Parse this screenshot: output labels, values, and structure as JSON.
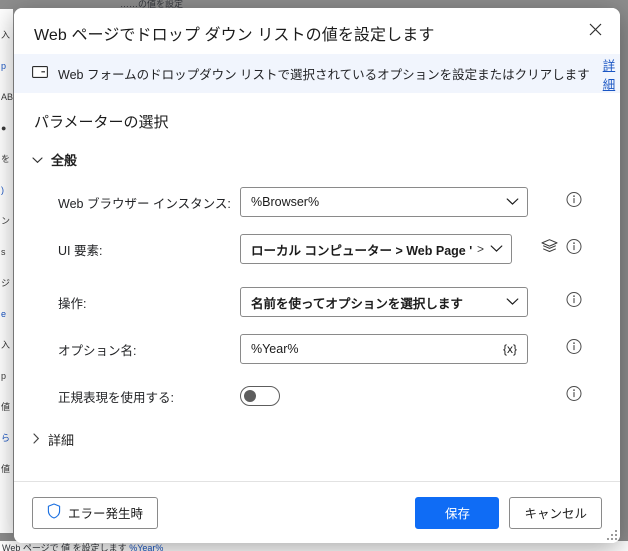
{
  "window": {
    "title": "Web ページでドロップ ダウン リストの値を設定します",
    "close_label": "×"
  },
  "banner": {
    "icon": "dropdown-list-icon",
    "text": "Web フォームのドロップダウン リストで選択されているオプションを設定またはクリアします",
    "link_label": "詳細"
  },
  "body": {
    "section_title": "パラメーターの選択",
    "groups": [
      {
        "label": "全般",
        "expanded": true,
        "chevron": "chevron-down-icon"
      },
      {
        "label": "詳細",
        "expanded": false,
        "chevron": "chevron-right-icon"
      }
    ],
    "fields": [
      {
        "label": "Web ブラウザー インスタンス:",
        "control": "dropdown",
        "value": "%Browser%",
        "bold": false,
        "suffix": "",
        "has_layers_icon": false,
        "has_info_icon": true
      },
      {
        "label": "UI 要素:",
        "control": "dropdown",
        "value": "ローカル コンピューター > Web Page 'h ... egist.html'",
        "bold": true,
        "suffix": ">",
        "has_layers_icon": true,
        "has_info_icon": true
      },
      {
        "label": "操作:",
        "control": "dropdown",
        "value": "名前を使ってオプションを選択します",
        "bold": true,
        "suffix": "",
        "has_layers_icon": false,
        "has_info_icon": true
      },
      {
        "label": "オプション名:",
        "control": "textfield",
        "value": "%Year%",
        "placeholder": "",
        "bold": false,
        "variable_button": "{x}",
        "has_layers_icon": false,
        "has_info_icon": true
      },
      {
        "label": "正規表現を使用する:",
        "control": "toggle",
        "value": "off",
        "has_layers_icon": false,
        "has_info_icon": true
      }
    ]
  },
  "footer": {
    "error_button_label": "エラー発生時",
    "error_button_icon": "shield-icon",
    "save_label": "保存",
    "cancel_label": "キャンセル"
  },
  "background": {
    "top_text": "……の値を設定",
    "bottom_text_plain": "Web ページで 値 を設定します",
    "bottom_text_link": "%Year%",
    "left_lines": [
      "入",
      "p",
      "AB",
      "●",
      "を",
      ")",
      "ン",
      "s",
      "ジ",
      "e",
      "入",
      "p",
      "値",
      "ら",
      "値"
    ]
  },
  "colors": {
    "accent": "#0f6cf5",
    "link": "#1a56c4",
    "banner_bg": "#f1f5fd",
    "border": "#8a8a8a",
    "desktop_bg": "#8d8d8d"
  }
}
